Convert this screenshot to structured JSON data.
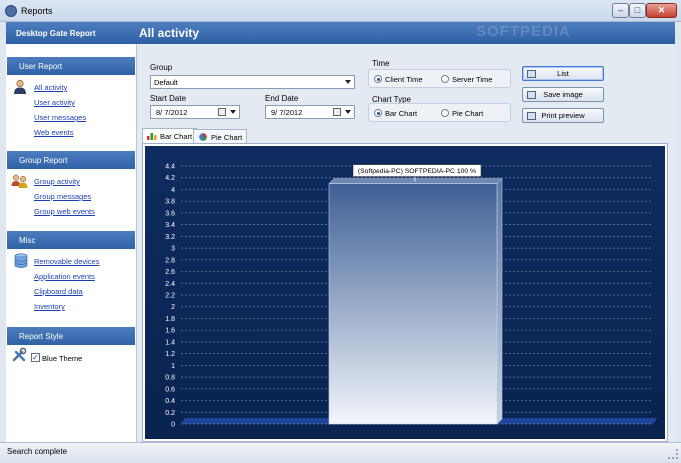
{
  "window": {
    "title": "Reports"
  },
  "header": {
    "app_label": "Desktop Gate Report",
    "view_title": "All activity",
    "watermark": "SOFTPEDIA"
  },
  "sidebar": {
    "user_report": {
      "title": "User Report",
      "items": [
        "All activity",
        "User activity",
        "User messages",
        "Web events"
      ]
    },
    "group_report": {
      "title": "Group Report",
      "items": [
        "Group activity",
        "Group messages",
        "Group web events"
      ]
    },
    "misc": {
      "title": "Misc",
      "items": [
        "Removable devices",
        "Application events",
        "Clipboard data",
        "Inventory"
      ]
    },
    "report_style": {
      "title": "Report Style",
      "blue_theme_label": "Blue Theme",
      "blue_theme_checked": true
    }
  },
  "filters": {
    "group_label": "Group",
    "group_value": "Default",
    "start_date_label": "Start Date",
    "start_date_value": "8/ 7/2012",
    "end_date_label": "End Date",
    "end_date_value": "9/ 7/2012",
    "time_label": "Time",
    "time_options": [
      "Client Time",
      "Server Time"
    ],
    "time_selected": "Client Time",
    "chart_type_label": "Chart Type",
    "chart_type_options": [
      "Bar Chart",
      "Pie Chart"
    ],
    "chart_type_selected": "Bar Chart"
  },
  "actions": {
    "list": "List",
    "save_image": "Save image",
    "print_preview": "Print preview"
  },
  "tabs": [
    {
      "label": "Bar Chart",
      "active": true
    },
    {
      "label": "Pie Chart",
      "active": false
    }
  ],
  "chart_data": {
    "type": "bar",
    "categories": [
      "(Softpedia-PC) SOFTPEDIA-PC"
    ],
    "values": [
      4.1
    ],
    "data_labels": [
      "(Softpedia-PC) SOFTPEDIA-PC 100 %"
    ],
    "y_ticks": [
      "0",
      "0.2",
      "0.4",
      "0.6",
      "0.8",
      "1",
      "1.2",
      "1.4",
      "1.6",
      "1.8",
      "2",
      "2.2",
      "2.4",
      "2.6",
      "2.8",
      "3",
      "3.2",
      "3.4",
      "3.6",
      "3.8",
      "4",
      "4.2",
      "4.4"
    ],
    "ylim": [
      0,
      4.4
    ],
    "grid": true,
    "colors": {
      "background": "#0d2a5a",
      "bar_top": "#3e5f95",
      "bar_bottom": "#f3f6fb",
      "grid": "#6f86ad",
      "text": "#ffffff"
    }
  },
  "status": {
    "text": "Search complete"
  }
}
